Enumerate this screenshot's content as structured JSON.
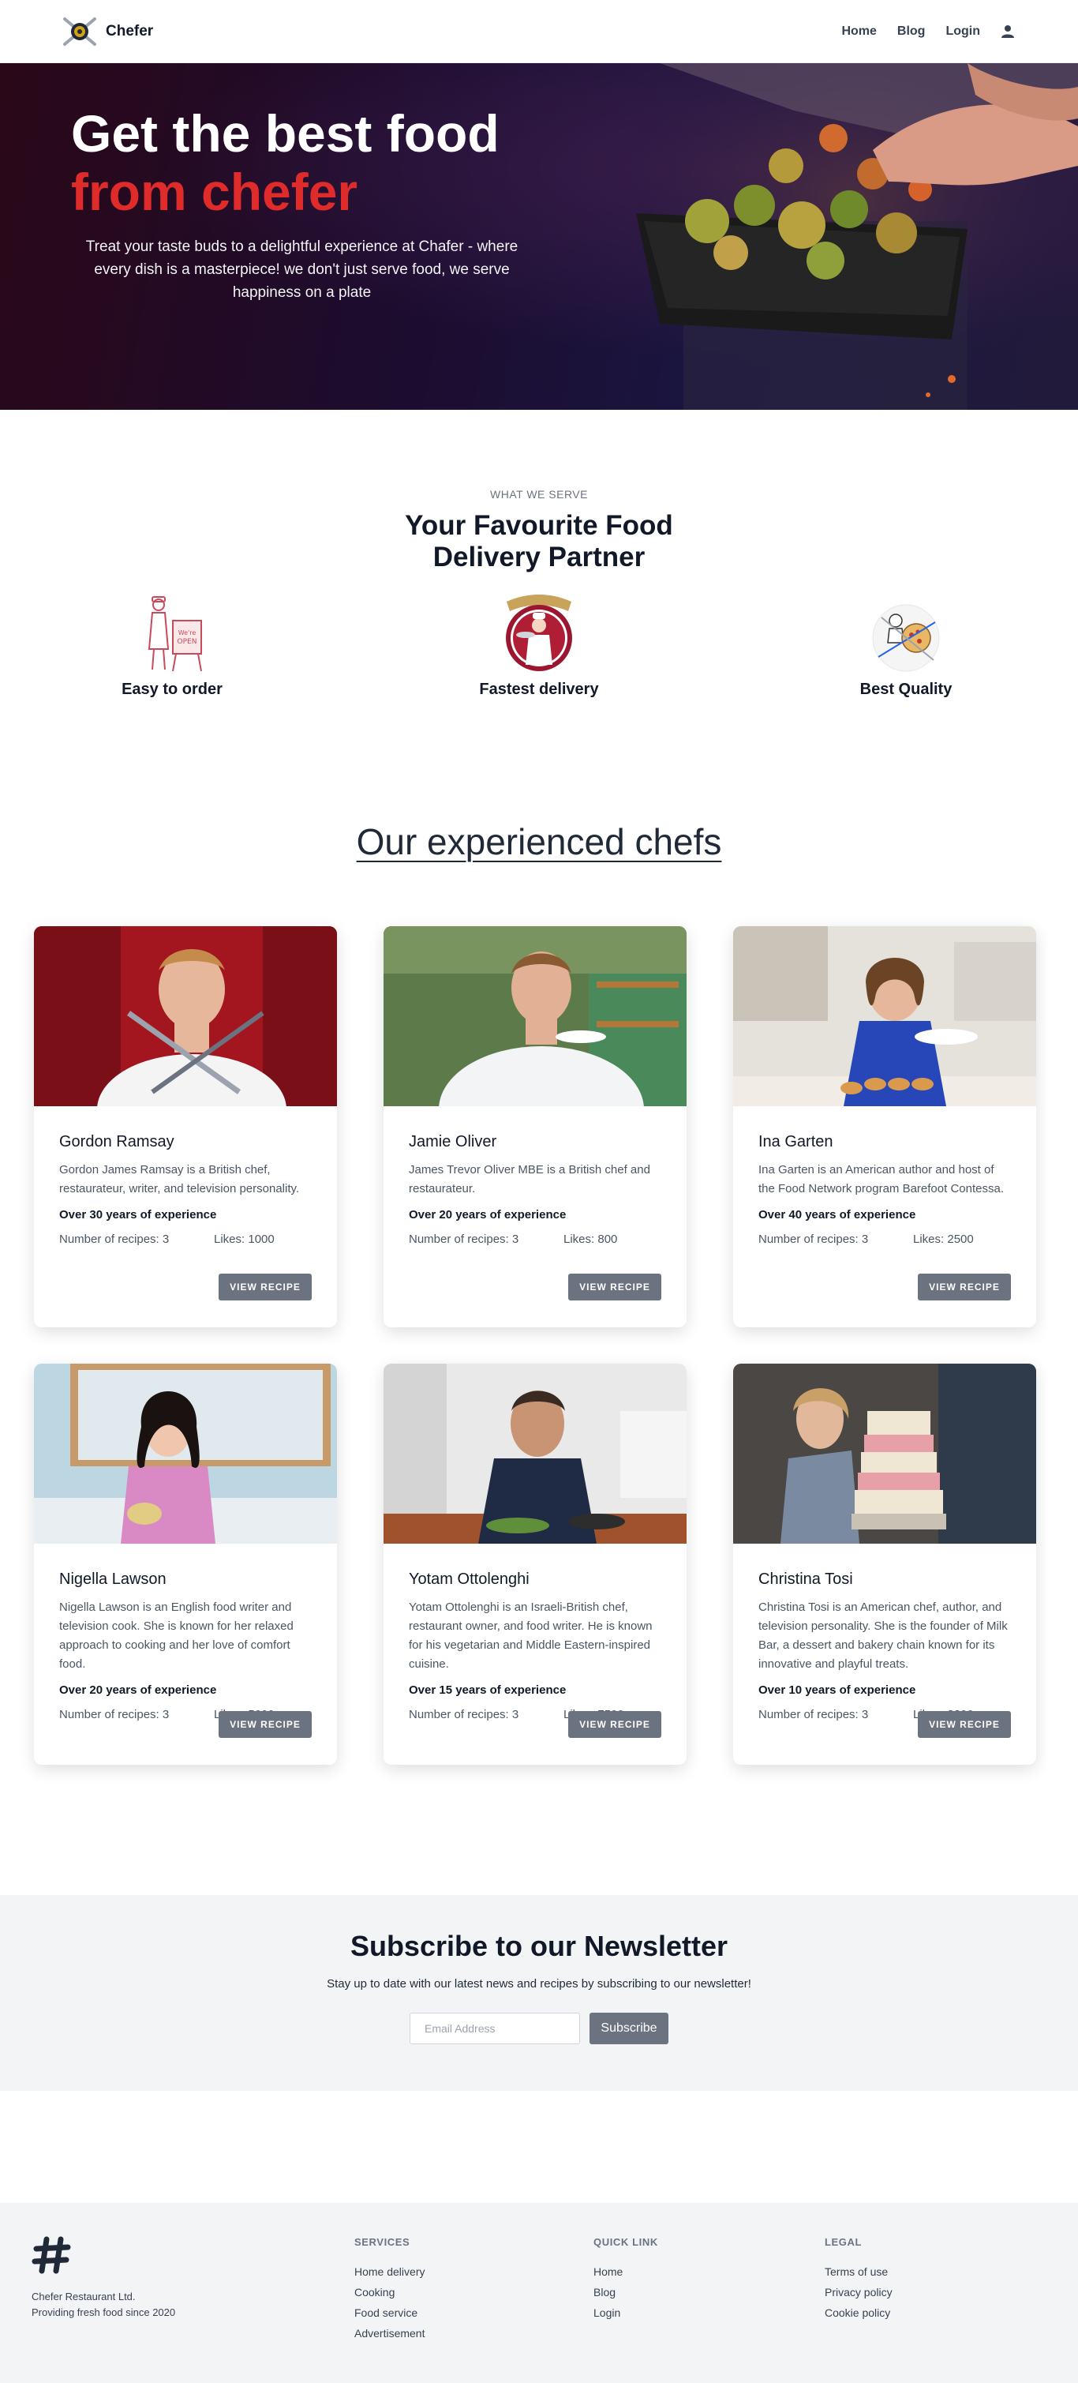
{
  "nav": {
    "brand": "Chefer",
    "links": [
      "Home",
      "Blog",
      "Login"
    ]
  },
  "hero": {
    "title_line1": "Get the best food",
    "title_line2": "from chefer",
    "subtitle": "Treat your taste buds to a delightful experience at Chafer - where every dish is a masterpiece! we don't just serve food, we serve happiness on a plate"
  },
  "serve": {
    "eyebrow": "WHAT WE SERVE",
    "title": "Your Favourite Food Delivery Partner",
    "features": [
      {
        "label": "Easy to order",
        "icon": "chef-open-sign-icon"
      },
      {
        "label": "Fastest delivery",
        "icon": "chef-badge-icon"
      },
      {
        "label": "Best Quality",
        "icon": "chef-pizza-icon"
      }
    ]
  },
  "chefs": {
    "title": "Our experienced chefs",
    "recipes_prefix": "Number of recipes:",
    "likes_prefix": "Likes:",
    "button_label": "VIEW RECIPE",
    "items": [
      {
        "name": "Gordon Ramsay",
        "desc": "Gordon James Ramsay is a British chef, restaurateur, writer, and television personality.",
        "exp": "Over 30 years of experience",
        "recipes": "Number of recipes: 3",
        "likes": "Likes: 1000"
      },
      {
        "name": "Jamie Oliver",
        "desc": "James Trevor Oliver MBE is a British chef and restaurateur.",
        "exp": "Over 20 years of experience",
        "recipes": "Number of recipes: 3",
        "likes": "Likes: 800"
      },
      {
        "name": "Ina Garten",
        "desc": "Ina Garten is an American author and host of the Food Network program Barefoot Contessa.",
        "exp": "Over 40 years of experience",
        "recipes": "Number of recipes: 3",
        "likes": "Likes: 2500"
      },
      {
        "name": "Nigella Lawson",
        "desc": "Nigella Lawson is an English food writer and television cook. She is known for her relaxed approach to cooking and her love of comfort food.",
        "exp": "Over 20 years of experience",
        "recipes": "Number of recipes: 3",
        "likes": "Likes: 5000"
      },
      {
        "name": "Yotam Ottolenghi",
        "desc": "Yotam Ottolenghi is an Israeli-British chef, restaurant owner, and food writer. He is known for his vegetarian and Middle Eastern-inspired cuisine.",
        "exp": "Over 15 years of experience",
        "recipes": "Number of recipes: 3",
        "likes": "Likes: 7500"
      },
      {
        "name": "Christina Tosi",
        "desc": "Christina Tosi is an American chef, author, and television personality. She is the founder of Milk Bar, a dessert and bakery chain known for its innovative and playful treats.",
        "exp": "Over 10 years of experience",
        "recipes": "Number of recipes: 3",
        "likes": "Likes: 8200"
      }
    ]
  },
  "newsletter": {
    "title": "Subscribe to our Newsletter",
    "subtitle": "Stay up to date with our latest news and recipes by subscribing to our newsletter!",
    "placeholder": "Email Address",
    "button": "Subscribe"
  },
  "footer": {
    "company": "Chefer Restaurant Ltd.",
    "tagline": "Providing fresh food since 2020",
    "services": {
      "heading": "SERVICES",
      "links": [
        "Home delivery",
        "Cooking",
        "Food service",
        "Advertisement"
      ]
    },
    "quick": {
      "heading": "QUICK LINK",
      "links": [
        "Home",
        "Blog",
        "Login"
      ]
    },
    "legal": {
      "heading": "LEGAL",
      "links": [
        "Terms of use",
        "Privacy policy",
        "Cookie policy"
      ]
    }
  },
  "colors": {
    "accent_red": "#e02b2b",
    "button_gray": "#6b7280",
    "footer_bg": "#f3f4f6"
  }
}
